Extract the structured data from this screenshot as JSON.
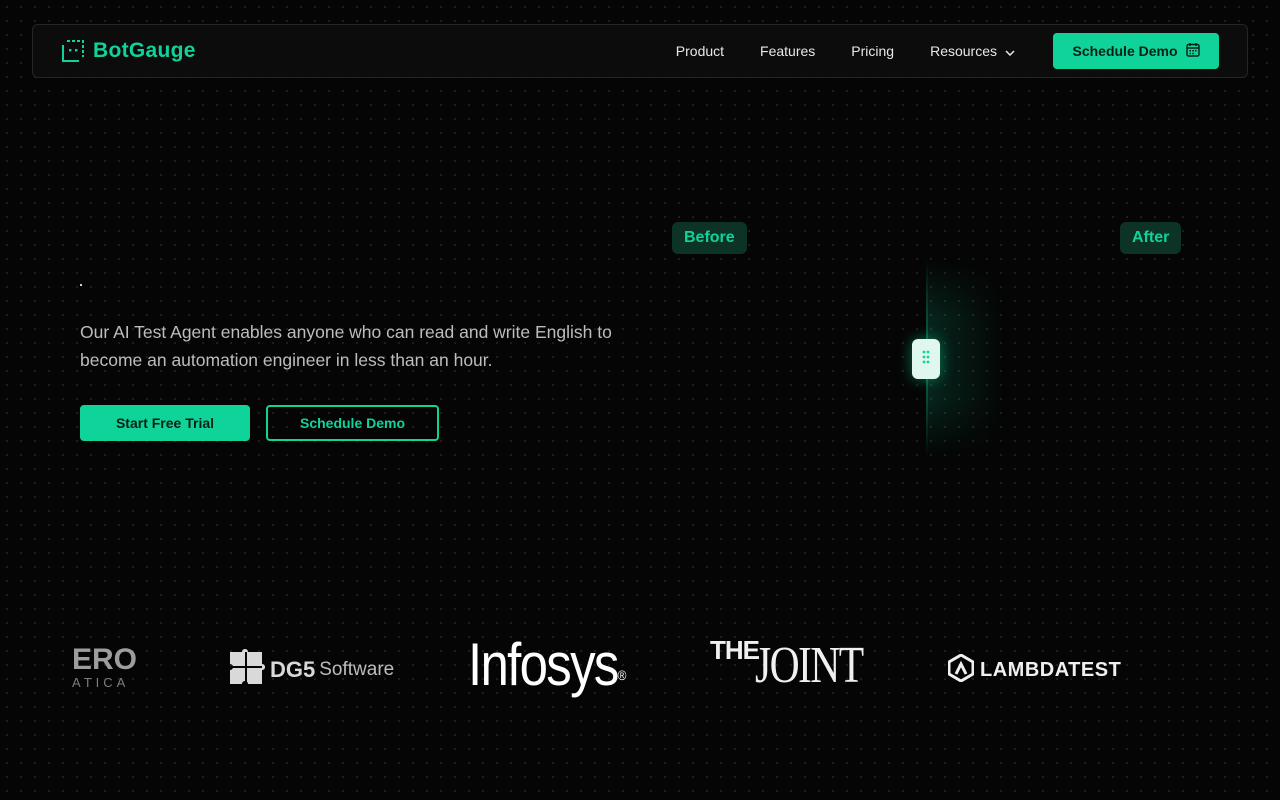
{
  "nav": {
    "logo_text": "BotGauge",
    "links": [
      "Product",
      "Features",
      "Pricing",
      "Resources"
    ],
    "cta_label": "Schedule Demo"
  },
  "hero": {
    "description": "Our AI Test Agent enables anyone who can read and write English to become an automation engineer in less than an hour.",
    "primary_label": "Start Free Trial",
    "secondary_label": "Schedule Demo"
  },
  "compare": {
    "before_label": "Before",
    "after_label": "After"
  },
  "logos": {
    "zero_top": "ERO",
    "zero_bottom": "ATICA",
    "dg5": "DG5",
    "dg5_suffix": "Software",
    "infosys": "Infosys",
    "joint_the": "THE",
    "joint_name": "JOINT",
    "lambdatest": "LAMBDATEST"
  },
  "colors": {
    "accent": "#10d39a",
    "background": "#050505",
    "tag_bg": "#0d3327"
  }
}
